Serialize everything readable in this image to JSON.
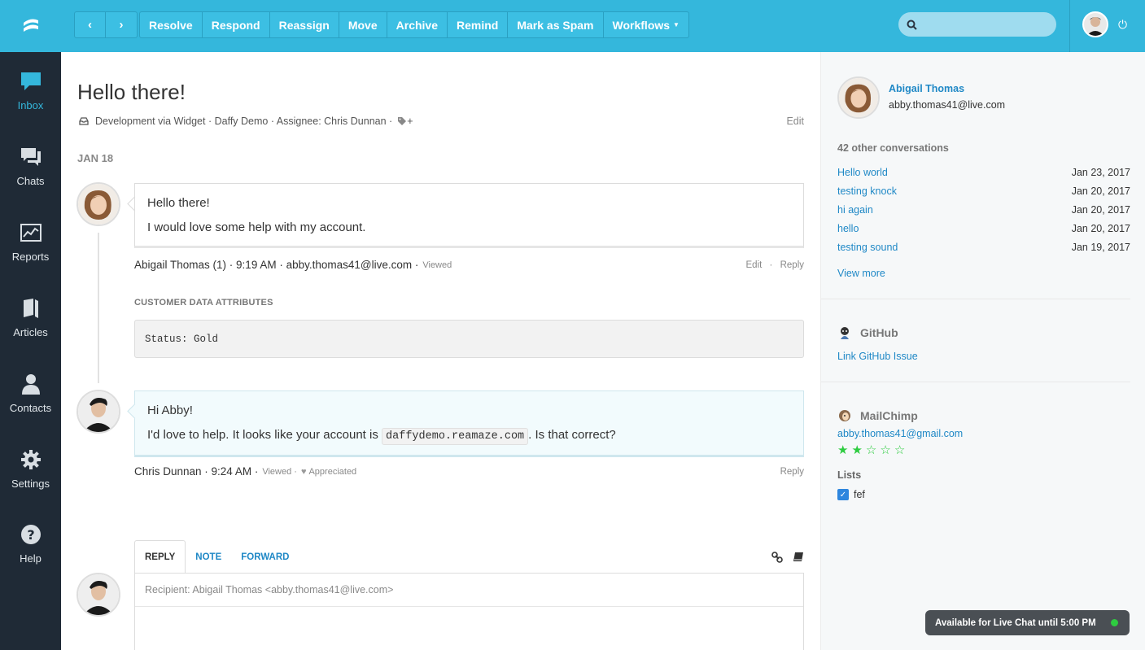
{
  "toolbar": {
    "back_label": "‹",
    "forward_label": "›",
    "actions": [
      "Resolve",
      "Respond",
      "Reassign",
      "Move",
      "Archive",
      "Remind",
      "Mark as Spam"
    ],
    "workflows_label": "Workflows"
  },
  "search": {
    "placeholder": ""
  },
  "sidebar": {
    "items": [
      {
        "label": "Inbox",
        "icon": "inbox-icon"
      },
      {
        "label": "Chats",
        "icon": "chats-icon"
      },
      {
        "label": "Reports",
        "icon": "reports-icon"
      },
      {
        "label": "Articles",
        "icon": "articles-icon"
      },
      {
        "label": "Contacts",
        "icon": "contacts-icon"
      },
      {
        "label": "Settings",
        "icon": "settings-icon"
      },
      {
        "label": "Help",
        "icon": "help-icon"
      }
    ]
  },
  "conversation": {
    "title": "Hello there!",
    "meta": "Development via Widget · Daffy Demo · Assignee: Chris Dunnan ·",
    "tag_add": "+",
    "edit_label": "Edit",
    "date_label": "JAN 18",
    "messages": [
      {
        "line1": "Hello there!",
        "line2": "I would love some help with my account.",
        "author_info": "Abigail Thomas (1) · 9:19 AM · abby.thomas41@live.com ·",
        "status": "Viewed",
        "edit": "Edit",
        "reply": "Reply"
      },
      {
        "line1": "Hi Abby!",
        "line2_pre": "I'd love to help. It looks like your account is",
        "line2_code": "daffydemo.reamaze.com",
        "line2_post": ". Is that correct?",
        "author_info": "Chris Dunnan · 9:24 AM ·",
        "status": "Viewed ·",
        "appreciated": "Appreciated",
        "reply": "Reply"
      }
    ],
    "cda_label": "CUSTOMER DATA ATTRIBUTES",
    "cda_value": "Status: Gold"
  },
  "reply_box": {
    "tabs": [
      "REPLY",
      "NOTE",
      "FORWARD"
    ],
    "recipient": "Recipient: Abigail Thomas <abby.thomas41@live.com>"
  },
  "customer": {
    "name": "Abigail Thomas",
    "email": "abby.thomas41@live.com",
    "other_conversations": "42 other conversations",
    "conversations": [
      {
        "title": "Hello world",
        "date": "Jan 23, 2017"
      },
      {
        "title": "testing knock",
        "date": "Jan 20, 2017"
      },
      {
        "title": "hi again",
        "date": "Jan 20, 2017"
      },
      {
        "title": "hello",
        "date": "Jan 20, 2017"
      },
      {
        "title": "testing sound",
        "date": "Jan 19, 2017"
      }
    ],
    "view_more": "View more"
  },
  "github": {
    "title": "GitHub",
    "link": "Link GitHub Issue"
  },
  "mailchimp": {
    "title": "MailChimp",
    "email": "abby.thomas41@gmail.com",
    "rating": 2,
    "rating_max": 5,
    "lists_label": "Lists",
    "list_item": "fef"
  },
  "live_chat": {
    "label": "Available for Live Chat until 5:00 PM"
  },
  "colors": {
    "brand": "#34b7dc",
    "sidebar": "#1f2a36",
    "link": "#1f88c6",
    "online": "#2ecc40"
  }
}
